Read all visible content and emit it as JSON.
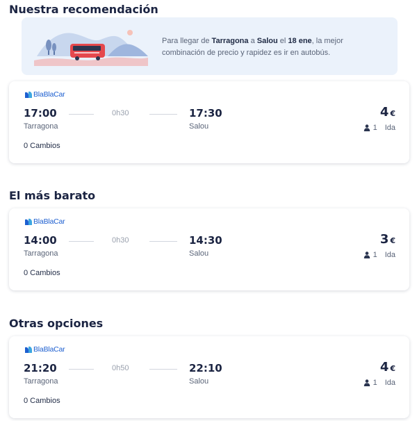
{
  "sections": {
    "recommended": "Nuestra recomendación",
    "cheapest": "El más barato",
    "others": "Otras opciones"
  },
  "banner": {
    "text_1": "Para llegar de ",
    "origin": "Tarragona",
    "text_2": " a ",
    "destination": "Salou",
    "text_3": " el ",
    "date": "18 ene",
    "text_4": ", la mejor combinación de precio y rapidez es ir en autobús."
  },
  "trips": [
    {
      "operator": "BlaBlaCar",
      "departure_time": "17:00",
      "arrival_time": "17:30",
      "duration": "0h30",
      "origin": "Tarragona",
      "destination": "Salou",
      "price": "4",
      "currency": "€",
      "passengers": "1",
      "trip_type": "Ida",
      "changes": "0 Cambios"
    },
    {
      "operator": "BlaBlaCar",
      "departure_time": "14:00",
      "arrival_time": "14:30",
      "duration": "0h30",
      "origin": "Tarragona",
      "destination": "Salou",
      "price": "3",
      "currency": "€",
      "passengers": "1",
      "trip_type": "Ida",
      "changes": "0 Cambios"
    },
    {
      "operator": "BlaBlaCar",
      "departure_time": "21:20",
      "arrival_time": "22:10",
      "duration": "0h50",
      "origin": "Tarragona",
      "destination": "Salou",
      "price": "4",
      "currency": "€",
      "passengers": "1",
      "trip_type": "Ida",
      "changes": "0 Cambios"
    }
  ],
  "icons": {
    "brand": "blablacar-logo-icon",
    "passenger": "person-icon",
    "illustration": "bus-landscape-illustration"
  },
  "colors": {
    "brand_blue": "#1d5fd0",
    "text_dark": "#1b2442",
    "banner_bg": "#ebf2fb",
    "bus_red": "#e5484d"
  }
}
